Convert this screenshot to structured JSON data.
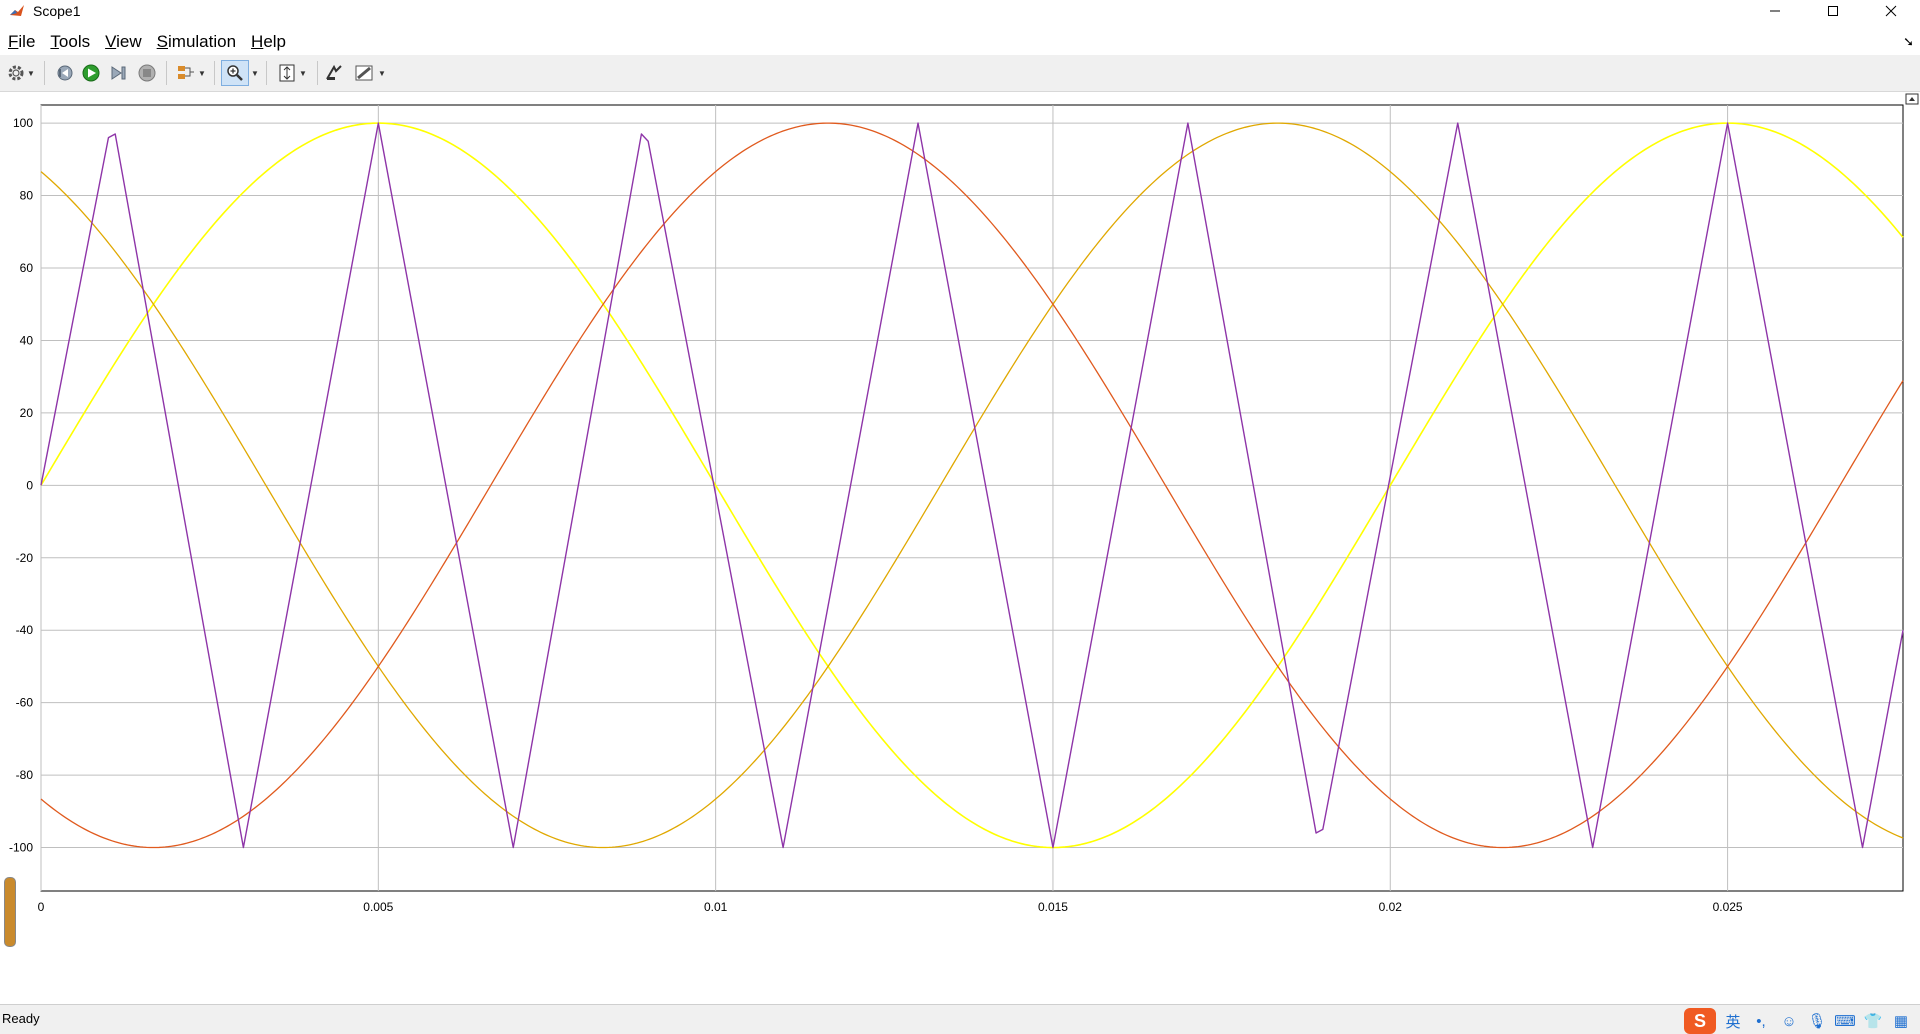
{
  "window": {
    "title": "Scope1"
  },
  "menu": {
    "items": [
      {
        "label": "File",
        "key": "F",
        "rest": "ile"
      },
      {
        "label": "Tools",
        "key": "T",
        "rest": "ools"
      },
      {
        "label": "View",
        "key": "V",
        "rest": "iew"
      },
      {
        "label": "Simulation",
        "key": "S",
        "rest": "imulation"
      },
      {
        "label": "Help",
        "key": "H",
        "rest": "elp"
      }
    ]
  },
  "toolbar": {
    "icons": [
      "settings-icon",
      "step-back-icon",
      "run-icon",
      "step-forward-icon",
      "stop-icon",
      "signal-selector-icon",
      "zoom-icon",
      "autoscale-icon",
      "highlight-simulink-block-icon",
      "style-icon"
    ]
  },
  "status": {
    "text": "Ready"
  },
  "tray": {
    "ime_label": "英",
    "brand_letter": "S"
  },
  "colors": {
    "series_a": "#ffff00",
    "series_b": "#e0a800",
    "series_c": "#e05a1e",
    "carrier": "#8e35a8",
    "grid": "#bfbfbf"
  },
  "chart_data": {
    "type": "line",
    "title": "",
    "xlabel": "",
    "ylabel": "",
    "xlim": [
      0,
      0.0276
    ],
    "ylim": [
      -112,
      105
    ],
    "xticks": [
      0,
      0.005,
      0.01,
      0.015,
      0.02,
      0.025
    ],
    "xtick_labels": [
      "0",
      "0.005",
      "0.01",
      "0.015",
      "0.02",
      "0.025"
    ],
    "yticks": [
      -100,
      -80,
      -60,
      -40,
      -20,
      0,
      20,
      40,
      60,
      80,
      100
    ],
    "ytick_labels": [
      "-100",
      "-80",
      "-60",
      "-40",
      "-20",
      "0",
      "20",
      "40",
      "60",
      "80",
      "100"
    ],
    "grid": true,
    "legend": "none",
    "series": [
      {
        "kind": "sine",
        "amplitude": 100,
        "frequency_hz": 50,
        "phase_deg": 0,
        "color": "#ffff00",
        "width": 1.6
      },
      {
        "kind": "sine",
        "amplitude": 100,
        "frequency_hz": 50,
        "phase_deg": 120,
        "color": "#e0a800",
        "width": 1.3
      },
      {
        "kind": "sine",
        "amplitude": 100,
        "frequency_hz": 50,
        "phase_deg": -120,
        "color": "#e05a1e",
        "width": 1.3
      },
      {
        "kind": "polyline",
        "color": "#8e35a8",
        "width": 1.4,
        "x": [
          0,
          0.001,
          0.0011,
          0.003,
          0.005,
          0.007,
          0.0089,
          0.009,
          0.011,
          0.013,
          0.015,
          0.017,
          0.0189,
          0.019,
          0.021,
          0.023,
          0.025,
          0.027,
          0.0276
        ],
        "y": [
          0,
          96,
          97,
          -100,
          100,
          -100,
          97,
          95,
          -100,
          100,
          -100,
          100,
          -96,
          -95,
          100,
          -100,
          100,
          -100,
          -40
        ]
      }
    ]
  }
}
